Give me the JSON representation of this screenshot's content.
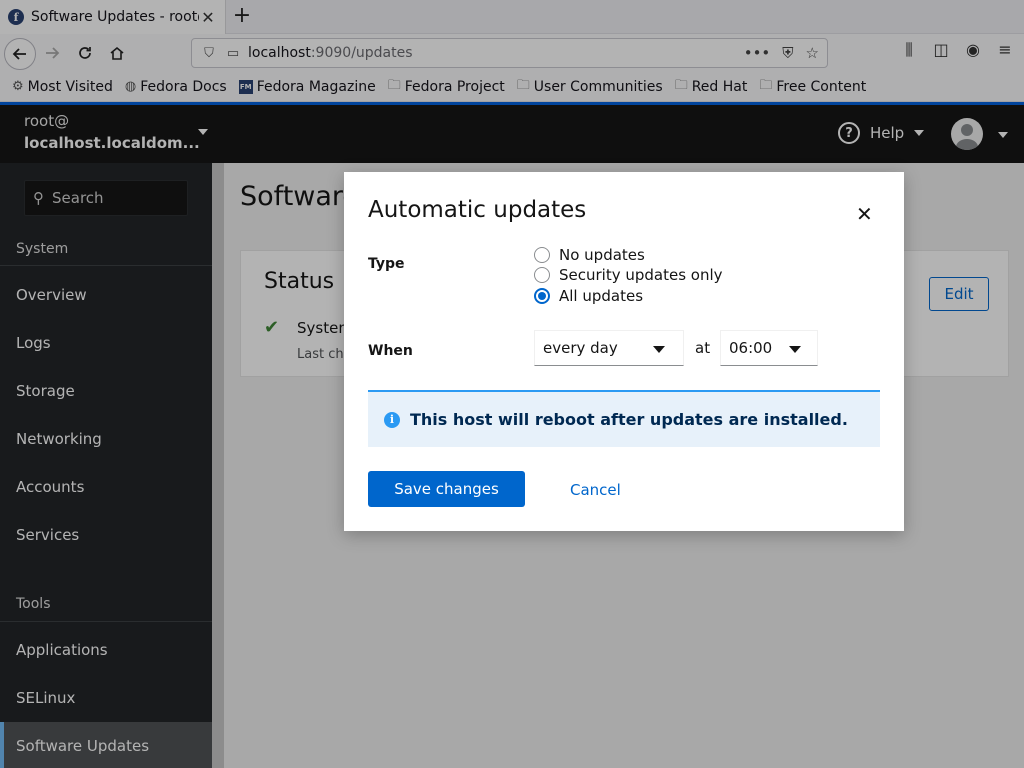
{
  "browser": {
    "tab_title": "Software Updates - root@",
    "tab_favicon": "f",
    "url_host": "localhost",
    "url_rest": ":9090/updates",
    "bookmarks": [
      {
        "label": "Most Visited",
        "icon": "gear-icon"
      },
      {
        "label": "Fedora Docs",
        "icon": "globe-icon"
      },
      {
        "label": "Fedora Magazine",
        "icon": "fedora-magazine-icon"
      },
      {
        "label": "Fedora Project",
        "icon": "folder-icon"
      },
      {
        "label": "User Communities",
        "icon": "folder-icon"
      },
      {
        "label": "Red Hat",
        "icon": "folder-icon"
      },
      {
        "label": "Free Content",
        "icon": "folder-icon"
      }
    ]
  },
  "sidebar": {
    "host_user": "root@",
    "host_name": "localhost.localdom...",
    "search_placeholder": "Search",
    "sections": [
      {
        "title": "System",
        "items": [
          "Overview",
          "Logs",
          "Storage",
          "Networking",
          "Accounts",
          "Services"
        ]
      },
      {
        "title": "Tools",
        "items": [
          "Applications",
          "SELinux",
          "Software Updates"
        ]
      }
    ],
    "active_item": "Software Updates",
    "accent": "#73bcf7"
  },
  "topbar": {
    "help_label": "Help"
  },
  "page": {
    "title": "Software Updates",
    "status_card": {
      "title": "Status",
      "status_line": "System is up to date",
      "last_checked": "Last checked:",
      "edit_label": "Edit"
    }
  },
  "modal": {
    "title": "Automatic updates",
    "type_label": "Type",
    "options": [
      "No updates",
      "Security updates only",
      "All updates"
    ],
    "selected_option": "All updates",
    "when_label": "When",
    "day_value": "every day",
    "at_label": "at",
    "time_value": "06:00",
    "alert_text": "This host will reboot after updates are installed.",
    "save_label": "Save changes",
    "cancel_label": "Cancel",
    "primary_color": "#0066cc"
  }
}
